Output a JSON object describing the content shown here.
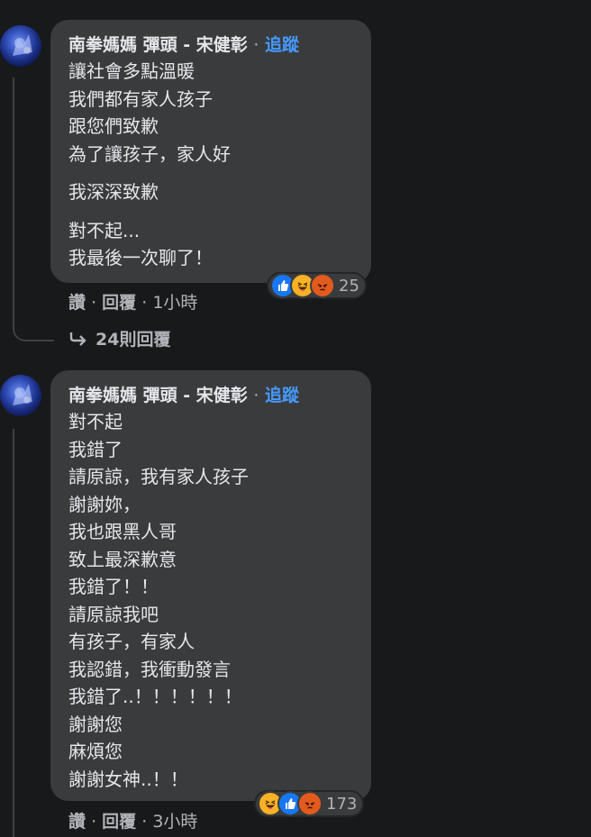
{
  "theme": {
    "background": "#18191a",
    "bubble": "#3a3b3c",
    "text": "#e4e6eb",
    "secondary_text": "#b0b3b8",
    "link": "#4599ff",
    "like_color": "#1877f2",
    "haha_color": "#f7b125",
    "angry_color": "#e25b1d"
  },
  "comments": [
    {
      "author": "南拳媽媽 彈頭 - 宋健彰",
      "separator": "·",
      "follow_label": "追蹤",
      "lines": [
        "讓社會多點溫暖",
        "我們都有家人孩子",
        "跟您們致歉",
        "為了讓孩子，家人好"
      ],
      "lines2": [
        "我深深致歉"
      ],
      "lines3": [
        "對不起...",
        "我最後一次聊了！"
      ],
      "reactions": [
        "like-icon",
        "haha-icon",
        "angry-icon"
      ],
      "reaction_count": "25",
      "like_label": "讚",
      "reply_label": "回覆",
      "time": "1小時",
      "view_replies": "24則回覆"
    },
    {
      "author": "南拳媽媽 彈頭 - 宋健彰",
      "separator": "·",
      "follow_label": "追蹤",
      "lines": [
        "對不起",
        "我錯了",
        "請原諒，我有家人孩子",
        "謝謝妳，",
        "我也跟黑人哥",
        "致上最深歉意",
        "我錯了！！",
        "請原諒我吧",
        "有孩子，有家人",
        "我認錯，我衝動發言",
        "我錯了..！！！！！！",
        "謝謝您",
        "麻煩您",
        "謝謝女神..！！"
      ],
      "reactions": [
        "haha-icon",
        "like-icon",
        "angry-icon"
      ],
      "reaction_count": "173",
      "like_label": "讚",
      "reply_label": "回覆",
      "time": "3小時"
    }
  ]
}
